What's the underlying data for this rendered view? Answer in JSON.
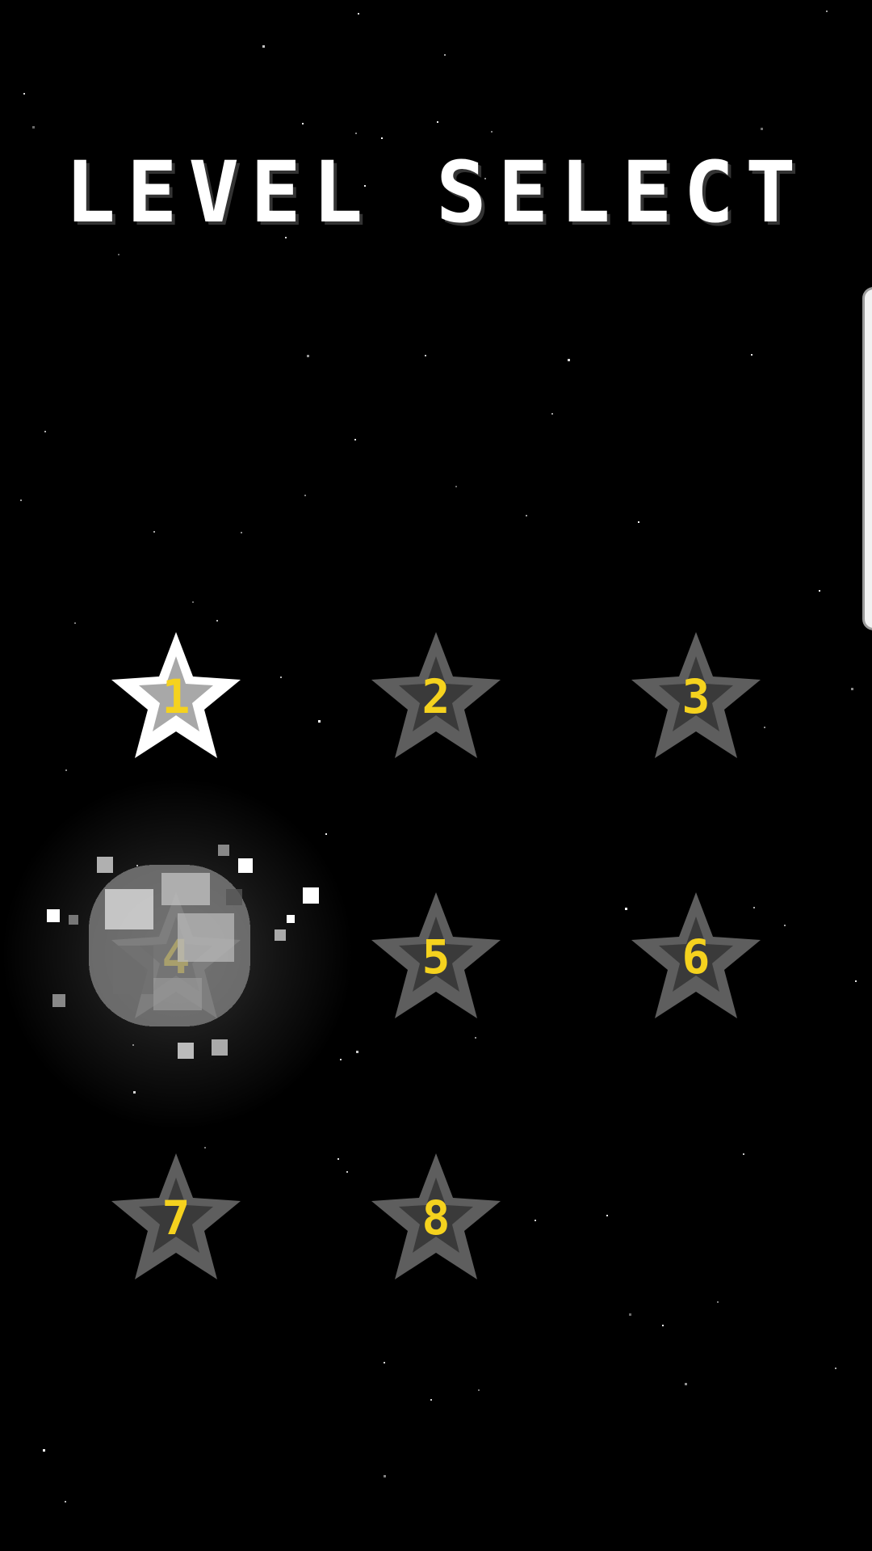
{
  "title": "LEVEL SELECT",
  "colors": {
    "background": "#000000",
    "title": "#ffffff",
    "number": "#f5d21e",
    "star_locked_outer": "#5e5e5e",
    "star_locked_inner": "#3a3a3a",
    "star_unlocked_outer": "#ffffff",
    "star_unlocked_inner": "#a8a8a8"
  },
  "levels": [
    {
      "number": "1",
      "state": "unlocked"
    },
    {
      "number": "2",
      "state": "locked"
    },
    {
      "number": "3",
      "state": "locked"
    },
    {
      "number": "4",
      "state": "locked"
    },
    {
      "number": "5",
      "state": "locked"
    },
    {
      "number": "6",
      "state": "locked"
    },
    {
      "number": "7",
      "state": "locked"
    },
    {
      "number": "8",
      "state": "locked"
    }
  ],
  "decoration": {
    "background_icon": "starfield",
    "overlay_icon": "asteroid-icon"
  }
}
